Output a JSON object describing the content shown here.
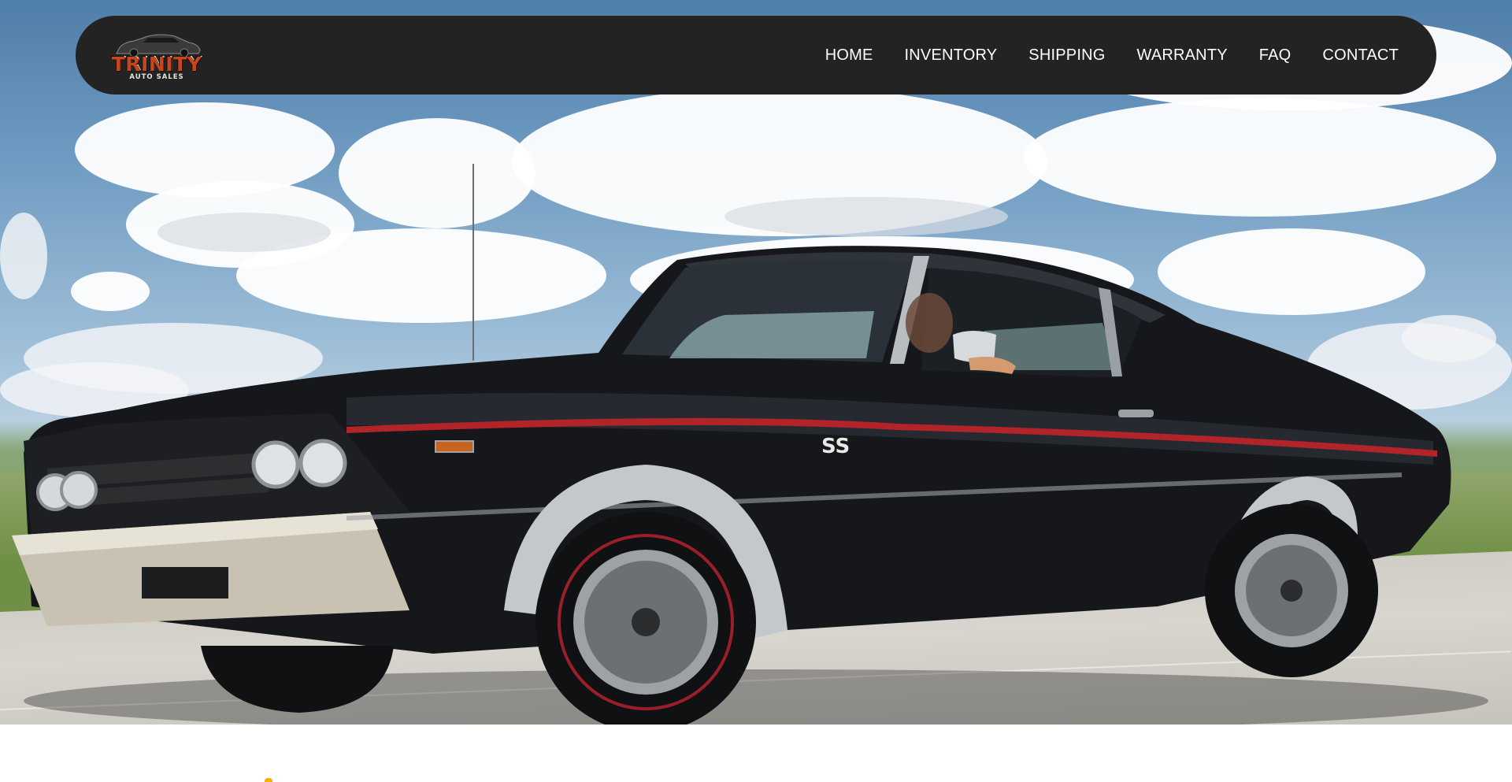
{
  "logo": {
    "brand": "TRINITY",
    "tagline": "AUTO SALES"
  },
  "nav": {
    "items": [
      {
        "label": "HOME"
      },
      {
        "label": "INVENTORY"
      },
      {
        "label": "SHIPPING"
      },
      {
        "label": "WARRANTY"
      },
      {
        "label": "FAQ"
      },
      {
        "label": "CONTACT"
      }
    ]
  },
  "hero": {
    "badge": "SS"
  },
  "colors": {
    "nav_bg": "#232323",
    "nav_text": "#ffffff",
    "logo_brand": "#c9461c",
    "car_body": "#141619",
    "car_stripe": "#b3232a"
  }
}
